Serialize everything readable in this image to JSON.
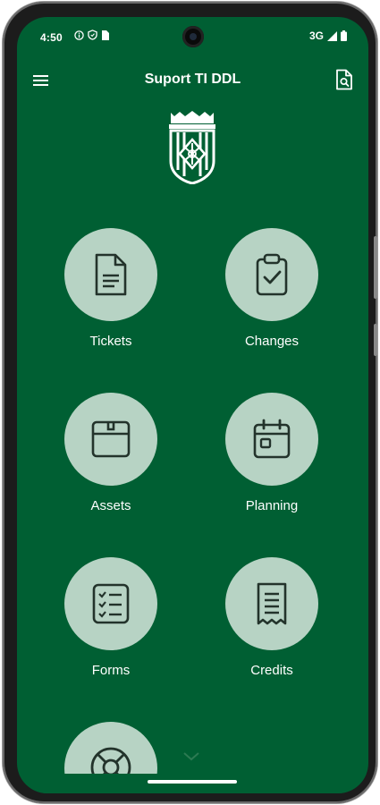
{
  "statusbar": {
    "time": "4:50",
    "network": "3G",
    "icons_left": [
      "info-circle-icon",
      "shield-icon",
      "sim-card-icon"
    ],
    "icons_right": [
      "signal-icon",
      "battery-icon"
    ]
  },
  "appbar": {
    "title": "Suport TI DDL",
    "left_icon": "hamburger-menu-icon",
    "right_icon": "document-search-icon"
  },
  "tiles": [
    {
      "label": "Tickets",
      "icon": "document-icon"
    },
    {
      "label": "Changes",
      "icon": "clipboard-check-icon"
    },
    {
      "label": "Assets",
      "icon": "box-icon"
    },
    {
      "label": "Planning",
      "icon": "calendar-icon"
    },
    {
      "label": "Forms",
      "icon": "checklist-icon"
    },
    {
      "label": "Credits",
      "icon": "receipt-icon"
    },
    {
      "label": "",
      "icon": "lifebuoy-icon"
    }
  ],
  "colors": {
    "background": "#005f33",
    "tile": "#b7d3c4",
    "icon": "#23332b",
    "text": "#ffffff"
  }
}
